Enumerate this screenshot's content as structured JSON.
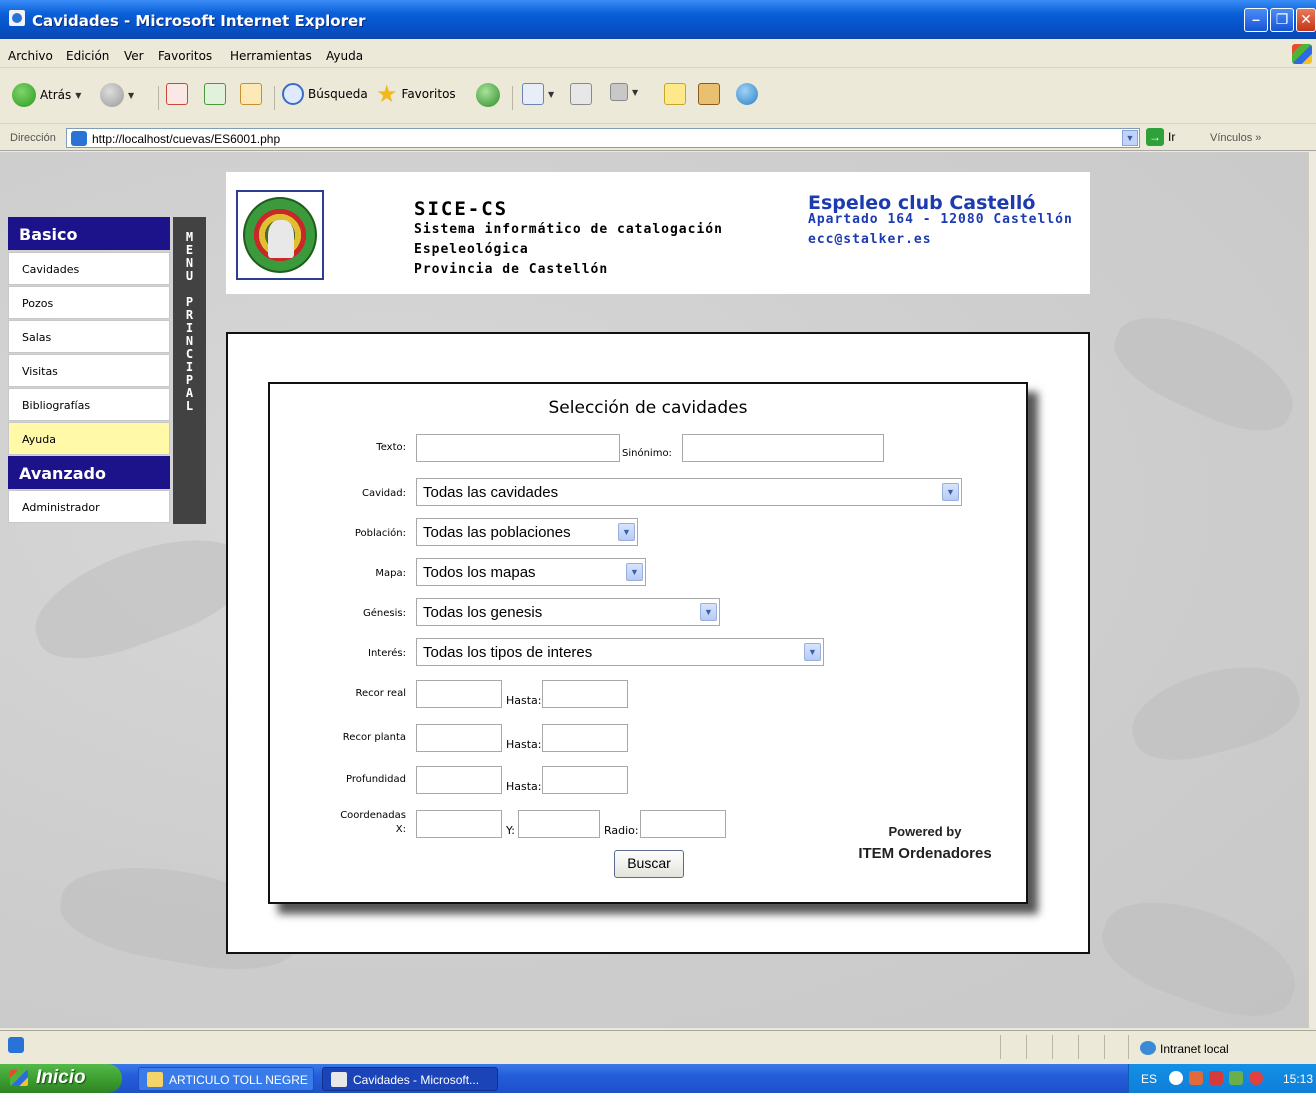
{
  "window": {
    "title": "Cavidades - Microsoft Internet Explorer"
  },
  "menu": [
    "Archivo",
    "Edición",
    "Ver",
    "Favoritos",
    "Herramientas",
    "Ayuda"
  ],
  "toolbar": {
    "back_label": "Atrás",
    "search_label": "Búsqueda",
    "favorites_label": "Favoritos"
  },
  "address": {
    "label": "Dirección",
    "url": "http://localhost/cuevas/ES6001.php",
    "go_label": "Ir",
    "links_label": "Vínculos"
  },
  "banner": {
    "title": "SICE-CS",
    "line1": "Sistema informático de catalogación",
    "line2": "Espeleológica",
    "line3": "Provincia de Castellón",
    "club_name": "Espeleo club Castelló",
    "club_address": "Apartado 164 - 12080 Castellón",
    "club_email": "ecc@stalker.es"
  },
  "sidebar": {
    "basic_header": "Basico",
    "items": [
      "Cavidades",
      "Pozos",
      "Salas",
      "Visitas",
      "Bibliografías",
      "Ayuda"
    ],
    "active_item": "Ayuda",
    "advanced_header": "Avanzado",
    "advanced_items": [
      "Administrador"
    ],
    "vertical_label": "MENU PRINCIPAL"
  },
  "form": {
    "title": "Selección de cavidades",
    "texto_label": "Texto:",
    "sinonimo_label": "Sinónimo:",
    "cavidad_label": "Cavidad:",
    "cavidad_value": "Todas las cavidades",
    "poblacion_label": "Población:",
    "poblacion_value": "Todas las poblaciones",
    "mapa_label": "Mapa:",
    "mapa_value": "Todos los mapas",
    "genesis_label": "Génesis:",
    "genesis_value": "Todas los genesis",
    "interes_label": "Interés:",
    "interes_value": "Todas los tipos de interes",
    "recor_real_label": "Recor real",
    "recor_planta_label": "Recor planta",
    "profundidad_label": "Profundidad",
    "coordenadas_label_1": "Coordenadas",
    "coordenadas_label_2": "X:",
    "hasta_label": "Hasta:",
    "y_label": "Y:",
    "radio_label": "Radio:",
    "search_button": "Buscar",
    "powered_line1": "Powered by",
    "powered_line2": "ITEM Ordenadores"
  },
  "status": {
    "zone": "Intranet local"
  },
  "taskbar": {
    "start_label": "Inicio",
    "tasks": [
      "ARTICULO TOLL NEGRE",
      "Cavidades - Microsoft..."
    ],
    "lang": "ES",
    "clock": "15:13"
  },
  "colors": {
    "titlebar": "#0a5fd8",
    "sidebar_header": "#1c138a",
    "active_item": "#fff9a8",
    "club_text": "#1d3bb0",
    "vertical_menu": "#424242"
  }
}
